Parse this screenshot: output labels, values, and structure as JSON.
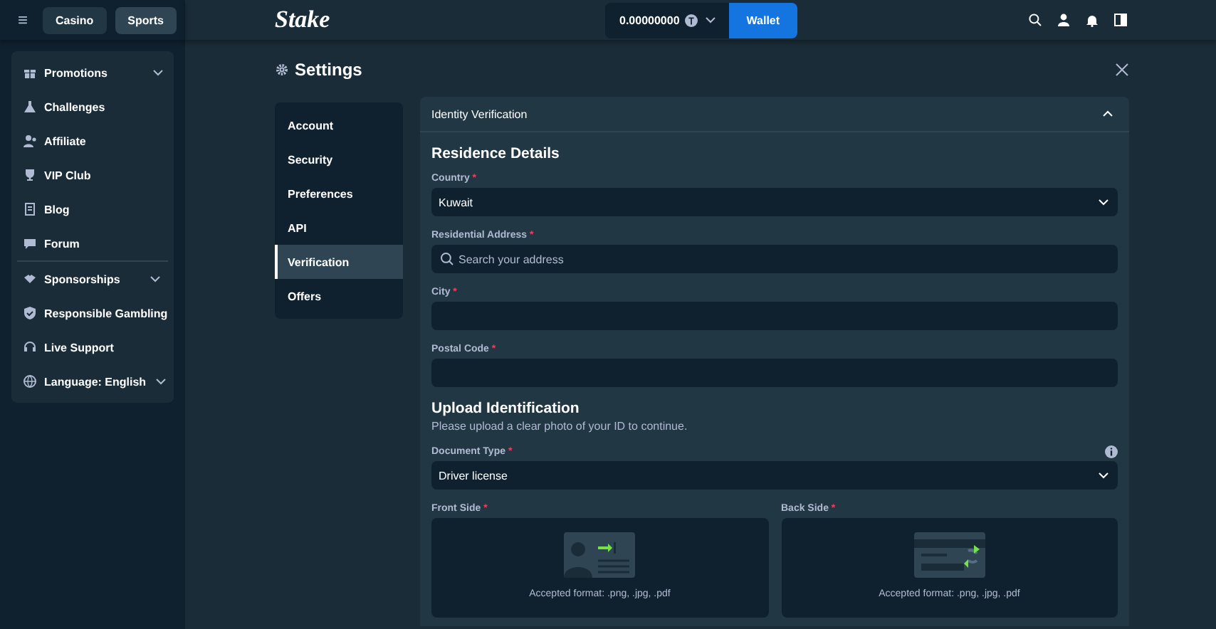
{
  "header": {
    "menu_icon": "≡",
    "tabs": [
      {
        "label": "Casino",
        "selected": false
      },
      {
        "label": "Sports",
        "selected": true
      }
    ],
    "logo": "Stake",
    "balance": "0.00000000",
    "wallet_button": "Wallet"
  },
  "sidebar": {
    "groups": [
      [
        {
          "label": "Promotions",
          "expandable": true
        },
        {
          "label": "Challenges",
          "expandable": false
        },
        {
          "label": "Affiliate",
          "expandable": false
        },
        {
          "label": "VIP Club",
          "expandable": false
        },
        {
          "label": "Blog",
          "expandable": false
        },
        {
          "label": "Forum",
          "expandable": false
        }
      ],
      [
        {
          "label": "Sponsorships",
          "expandable": true
        },
        {
          "label": "Responsible Gambling",
          "expandable": false
        },
        {
          "label": "Live Support",
          "expandable": false
        },
        {
          "label": "Language: English",
          "expandable": true
        }
      ]
    ]
  },
  "settings": {
    "title": "Settings",
    "nav": [
      {
        "label": "Account",
        "selected": false
      },
      {
        "label": "Security",
        "selected": false
      },
      {
        "label": "Preferences",
        "selected": false
      },
      {
        "label": "API",
        "selected": false
      },
      {
        "label": "Verification",
        "selected": true
      },
      {
        "label": "Offers",
        "selected": false
      }
    ],
    "panel": {
      "title": "Identity Verification",
      "expanded": true,
      "sections": [
        {
          "heading": "Residence Details",
          "fields": [
            {
              "kind": "select",
              "label": "Country",
              "mark": "*",
              "value": "Kuwait"
            },
            {
              "kind": "search",
              "label": "Residential Address",
              "mark": "*",
              "placeholder": "Search your address"
            },
            {
              "kind": "text",
              "label": "City",
              "mark": "*"
            },
            {
              "kind": "text",
              "label": "Postal Code",
              "mark": "*"
            }
          ]
        },
        {
          "heading": "Upload Identification",
          "note": "Please upload a clear photo of your ID to continue.",
          "fields": [
            {
              "kind": "select",
              "label": "Document Type",
              "mark": "*",
              "value": "Driver license",
              "info": true
            }
          ],
          "uploads": [
            {
              "label": "Front Side",
              "mark": "*",
              "format": "Accepted format: .png, .jpg, .pdf"
            },
            {
              "label": "Back Side",
              "mark": "*",
              "format": "Accepted format: .png, .jpg, .pdf"
            }
          ]
        }
      ]
    }
  }
}
